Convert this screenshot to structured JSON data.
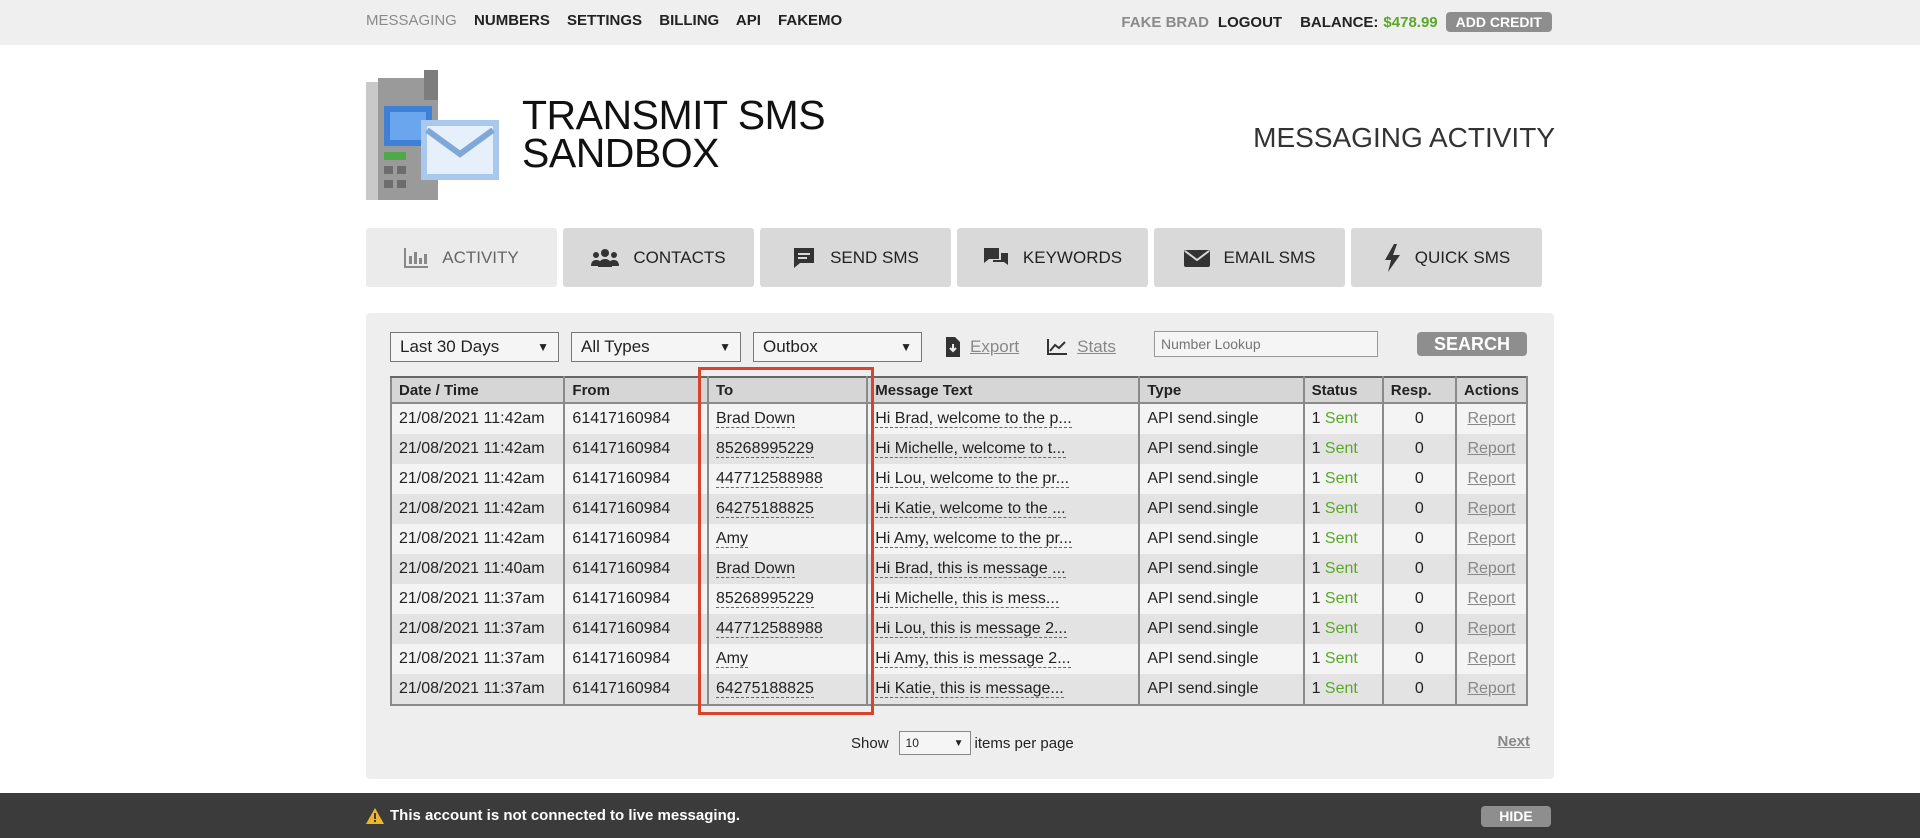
{
  "topnav": {
    "items": [
      "MESSAGING",
      "NUMBERS",
      "SETTINGS",
      "BILLING",
      "API",
      "FAKEMO"
    ],
    "user": "FAKE BRAD",
    "logout": "LOGOUT",
    "balance_label": "BALANCE:",
    "balance_value": "$478.99",
    "add_credit": "ADD CREDIT"
  },
  "brand": {
    "line1": "TRANSMIT SMS",
    "line2": "SANDBOX"
  },
  "page_title": "MESSAGING ACTIVITY",
  "tabs": [
    {
      "label": "ACTIVITY",
      "icon": "bar-chart-icon"
    },
    {
      "label": "CONTACTS",
      "icon": "users-icon"
    },
    {
      "label": "SEND SMS",
      "icon": "message-icon"
    },
    {
      "label": "KEYWORDS",
      "icon": "comments-icon"
    },
    {
      "label": "EMAIL SMS",
      "icon": "envelope-icon"
    },
    {
      "label": "QUICK SMS",
      "icon": "bolt-icon"
    }
  ],
  "filters": {
    "period": "Last 30 Days",
    "types": "All Types",
    "box": "Outbox",
    "export": "Export",
    "stats": "Stats",
    "lookup_placeholder": "Number Lookup",
    "search": "SEARCH"
  },
  "table": {
    "headers": [
      "Date / Time",
      "From",
      "To",
      "Message Text",
      "Type",
      "Status",
      "Resp.",
      "Actions"
    ],
    "rows": [
      {
        "date": "21/08/2021 11:42am",
        "from": "61417160984",
        "to": "Brad Down",
        "text": "Hi Brad, welcome to the p...",
        "type": "API send.single",
        "count": "1",
        "status": "Sent",
        "resp": "0",
        "action": "Report"
      },
      {
        "date": "21/08/2021 11:42am",
        "from": "61417160984",
        "to": "85268995229",
        "text": "Hi Michelle, welcome to t...",
        "type": "API send.single",
        "count": "1",
        "status": "Sent",
        "resp": "0",
        "action": "Report"
      },
      {
        "date": "21/08/2021 11:42am",
        "from": "61417160984",
        "to": "447712588988",
        "text": "Hi Lou, welcome to the pr...",
        "type": "API send.single",
        "count": "1",
        "status": "Sent",
        "resp": "0",
        "action": "Report"
      },
      {
        "date": "21/08/2021 11:42am",
        "from": "61417160984",
        "to": "64275188825",
        "text": "Hi Katie, welcome to the ...",
        "type": "API send.single",
        "count": "1",
        "status": "Sent",
        "resp": "0",
        "action": "Report"
      },
      {
        "date": "21/08/2021 11:42am",
        "from": "61417160984",
        "to": "Amy",
        "text": "Hi Amy, welcome to the pr...",
        "type": "API send.single",
        "count": "1",
        "status": "Sent",
        "resp": "0",
        "action": "Report"
      },
      {
        "date": "21/08/2021 11:40am",
        "from": "61417160984",
        "to": "Brad Down",
        "text": "Hi Brad, this is message ...",
        "type": "API send.single",
        "count": "1",
        "status": "Sent",
        "resp": "0",
        "action": "Report"
      },
      {
        "date": "21/08/2021 11:37am",
        "from": "61417160984",
        "to": "85268995229",
        "text": "Hi Michelle, this is mess...",
        "type": "API send.single",
        "count": "1",
        "status": "Sent",
        "resp": "0",
        "action": "Report"
      },
      {
        "date": "21/08/2021 11:37am",
        "from": "61417160984",
        "to": "447712588988",
        "text": "Hi Lou, this is message 2...",
        "type": "API send.single",
        "count": "1",
        "status": "Sent",
        "resp": "0",
        "action": "Report"
      },
      {
        "date": "21/08/2021 11:37am",
        "from": "61417160984",
        "to": "Amy",
        "text": "Hi Amy, this is message 2...",
        "type": "API send.single",
        "count": "1",
        "status": "Sent",
        "resp": "0",
        "action": "Report"
      },
      {
        "date": "21/08/2021 11:37am",
        "from": "61417160984",
        "to": "64275188825",
        "text": "Hi Katie, this is message...",
        "type": "API send.single",
        "count": "1",
        "status": "Sent",
        "resp": "0",
        "action": "Report"
      }
    ]
  },
  "pager": {
    "show": "Show",
    "per_page": "10",
    "items_label": "items per page",
    "next": "Next"
  },
  "footer": {
    "message": "This account is not connected to live messaging.",
    "hide": "HIDE"
  },
  "colors": {
    "accent_green": "#5ba829",
    "highlight_red": "#d9432b",
    "footer_bg": "#3b3b3b"
  }
}
